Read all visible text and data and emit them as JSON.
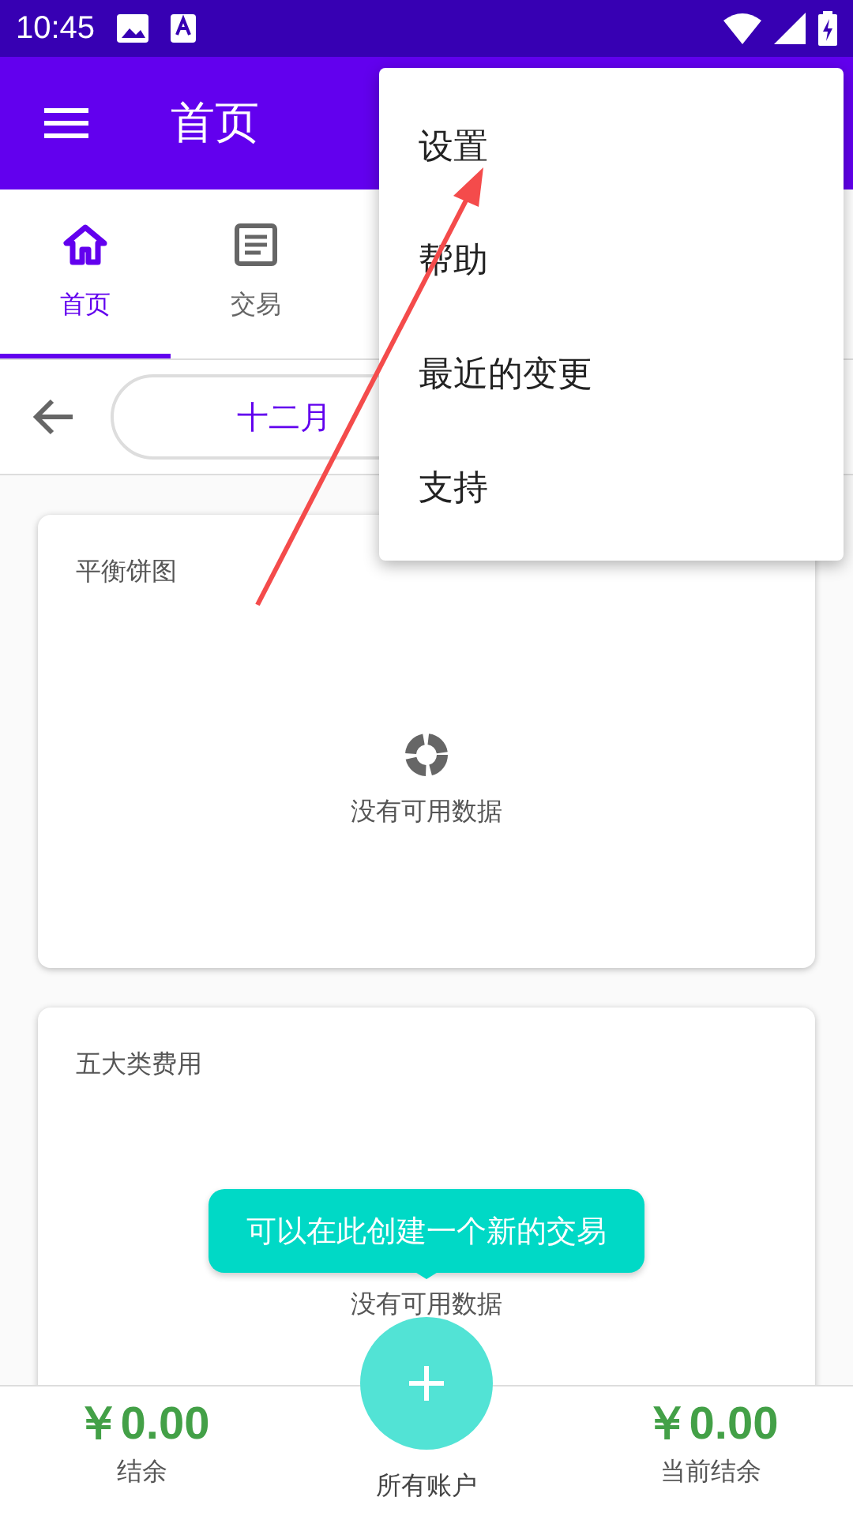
{
  "status_bar": {
    "time": "10:45"
  },
  "app_bar": {
    "title": "首页"
  },
  "tabs": [
    {
      "label": "首页",
      "selected": true,
      "kind": "home"
    },
    {
      "label": "交易",
      "selected": false,
      "kind": "list"
    }
  ],
  "month": {
    "label": "十二月"
  },
  "cards": [
    {
      "title": "平衡饼图",
      "empty_text": "没有可用数据",
      "icon": true
    },
    {
      "title": "五大类费用",
      "empty_text": "没有可用数据"
    }
  ],
  "tooltip": {
    "text": "可以在此创建一个新的交易"
  },
  "summary": [
    {
      "amount": "￥0.00",
      "label": "结余"
    },
    {
      "amount": "￥0.00",
      "label": "当前结余"
    }
  ],
  "account": {
    "label": "所有账户"
  },
  "menu": {
    "items": [
      "设置",
      "帮助",
      "最近的变更",
      "支持"
    ]
  }
}
